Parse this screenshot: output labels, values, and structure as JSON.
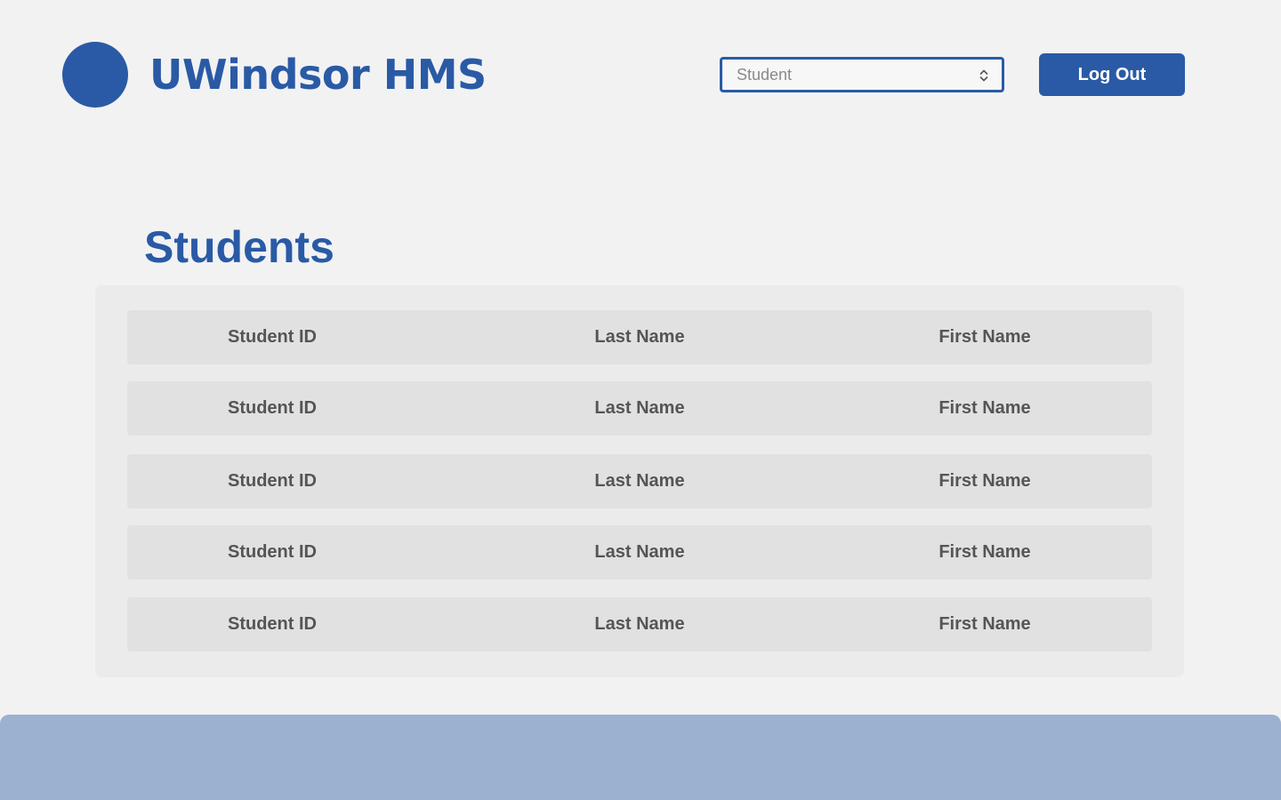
{
  "header": {
    "app_title": "UWindsor HMS",
    "role_select": {
      "selected": "Student"
    },
    "logout_label": "Log Out"
  },
  "main": {
    "page_title": "Students",
    "columns": [
      "Student ID",
      "Last Name",
      "First Name"
    ],
    "rows": [
      [
        "Student ID",
        "Last Name",
        "First Name"
      ],
      [
        "Student ID",
        "Last Name",
        "First Name"
      ],
      [
        "Student ID",
        "Last Name",
        "First Name"
      ],
      [
        "Student ID",
        "Last Name",
        "First Name"
      ],
      [
        "Student ID",
        "Last Name",
        "First Name"
      ]
    ]
  },
  "colors": {
    "brand": "#2a5aa5",
    "footer": "#9cb0d0",
    "background": "#f2f2f3"
  },
  "icons": {
    "logo": "logo-circle",
    "select_arrows": "chevron-up-down-icon"
  }
}
